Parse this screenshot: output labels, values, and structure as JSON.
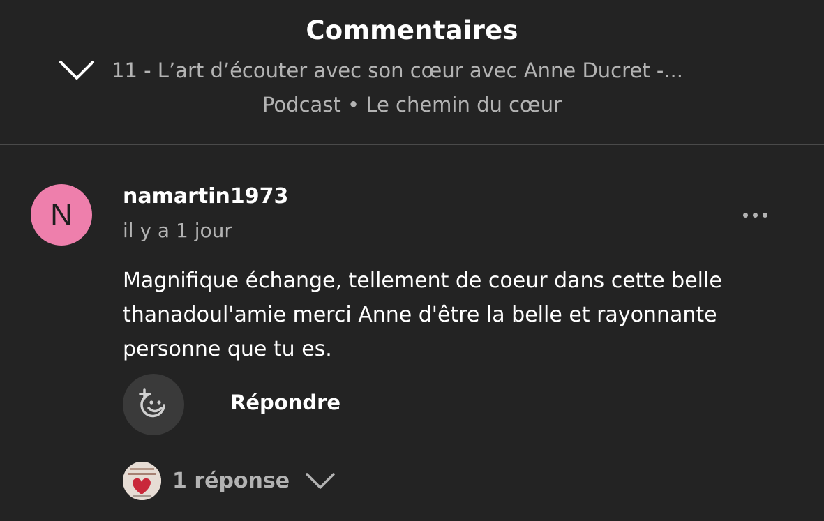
{
  "header": {
    "title": "Commentaires",
    "episode_title": "11 - L’art d’écouter avec son cœur avec Anne Ducret -...",
    "subtitle": "Podcast • Le chemin du cœur"
  },
  "comment": {
    "avatar_initial": "N",
    "username": "namartin1973",
    "timestamp": "il y a 1 jour",
    "text": "Magnifique échange, tellement de coeur dans cette belle thanadoul'amie merci Anne d'être la belle et rayonnante personne que tu es.",
    "reply_label": "Répondre",
    "replies_label": "1 réponse"
  },
  "icons": {
    "collapse": "chevron-down-icon",
    "more": "more-options-icon",
    "react": "add-reaction-icon",
    "replies_toggle": "chevron-down-icon"
  },
  "colors": {
    "background": "#232323",
    "avatar": "#ee7fac",
    "secondary_text": "#b3b3b3",
    "button_bg": "#3a3a3a"
  }
}
